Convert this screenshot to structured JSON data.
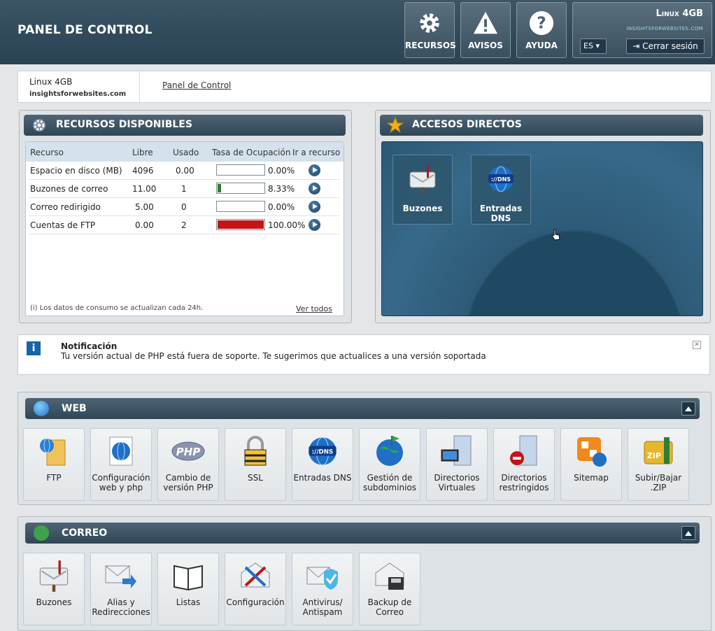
{
  "header": {
    "title": "PANEL DE CONTROL",
    "buttons": [
      {
        "label": "RECURSOS"
      },
      {
        "label": "AVISOS"
      },
      {
        "label": "AYUDA"
      }
    ],
    "account": {
      "plan": "Linux 4GB",
      "domain": "insightsforwebsites.com",
      "lang": "ES",
      "logout": "Cerrar sesión"
    }
  },
  "breadcrumb": {
    "plan": "Linux 4GB",
    "domain": "insightsforwebsites.com",
    "link": "Panel de Control"
  },
  "resources": {
    "title": "RECURSOS DISPONIBLES",
    "columns": [
      "Recurso",
      "Libre",
      "Usado",
      "Tasa de Ocupación",
      "Ir a recurso"
    ],
    "rows": [
      {
        "name": "Espacio en disco (MB)",
        "free": "4096",
        "used": "0.00",
        "pct": "0.00%",
        "ratio": 0,
        "color": "#2f7d2f"
      },
      {
        "name": "Buzones de correo",
        "free": "11.00",
        "used": "1",
        "pct": "8.33%",
        "ratio": 0.0833,
        "color": "#2f7d2f"
      },
      {
        "name": "Correo redirigido",
        "free": "5.00",
        "used": "0",
        "pct": "0.00%",
        "ratio": 0,
        "color": "#2f7d2f"
      },
      {
        "name": "Cuentas de FTP",
        "free": "0.00",
        "used": "2",
        "pct": "100.00%",
        "ratio": 1,
        "color": "#c41414"
      }
    ],
    "note": "(i) Los datos de consumo se actualizan cada 24h.",
    "view_all": "Ver todos"
  },
  "shortcuts": {
    "title": "ACCESOS DIRECTOS",
    "items": [
      {
        "label": "Buzones",
        "icon": "mailbox-icon"
      },
      {
        "label": "Entradas DNS",
        "icon": "dns-globe-icon"
      }
    ]
  },
  "notification": {
    "title": "Notificación",
    "message": "Tu versión actual de PHP está fuera de soporte. Te sugerimos que actualices a una versión soportada"
  },
  "web": {
    "title": "WEB",
    "items": [
      {
        "label": "FTP",
        "icon": "ftp-folder-icon"
      },
      {
        "label": "Configuración web y php",
        "icon": "web-config-icon"
      },
      {
        "label": "Cambio de versión PHP",
        "icon": "php-icon"
      },
      {
        "label": "SSL",
        "icon": "padlock-icon"
      },
      {
        "label": "Entradas DNS",
        "icon": "dns-globe-icon"
      },
      {
        "label": "Gestión de subdominios",
        "icon": "subdomain-globe-icon"
      },
      {
        "label": "Directorios Virtuales",
        "icon": "virtual-dir-icon"
      },
      {
        "label": "Directorios restringidos",
        "icon": "restricted-dir-icon"
      },
      {
        "label": "Sitemap",
        "icon": "sitemap-icon"
      },
      {
        "label": "Subir/Bajar .ZIP",
        "icon": "zip-icon"
      }
    ]
  },
  "mail": {
    "title": "CORREO",
    "items": [
      {
        "label": "Buzones",
        "icon": "mailbox-icon"
      },
      {
        "label": "Alias y Redirecciones",
        "icon": "mail-forward-icon"
      },
      {
        "label": "Listas",
        "icon": "book-icon"
      },
      {
        "label": "Configuración",
        "icon": "mail-tools-icon"
      },
      {
        "label": "Antivirus/ Antispam",
        "icon": "mail-shield-icon"
      },
      {
        "label": "Backup de Correo",
        "icon": "mail-backup-icon"
      }
    ]
  }
}
